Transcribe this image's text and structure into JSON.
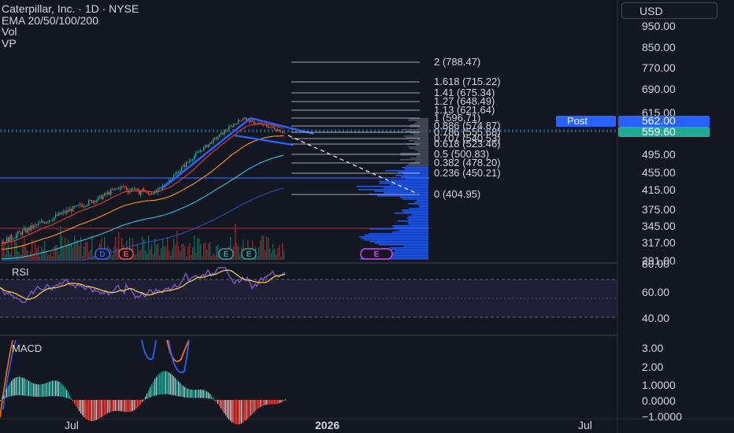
{
  "legend": {
    "symbol": "Caterpillar, Inc. · 1D · NYSE",
    "ema": "EMA 20/50/100/200",
    "vol": "Vol",
    "vp": "VP"
  },
  "currency": "USD",
  "price_axis": {
    "labels": [
      {
        "text": "950.00",
        "value": 950
      },
      {
        "text": "850.00",
        "value": 850
      },
      {
        "text": "770.00",
        "value": 770
      },
      {
        "text": "690.00",
        "value": 690
      },
      {
        "text": "615.00",
        "value": 615
      },
      {
        "text": "495.00",
        "value": 495
      },
      {
        "text": "455.00",
        "value": 455
      },
      {
        "text": "415.00",
        "value": 415
      },
      {
        "text": "375.00",
        "value": 375
      },
      {
        "text": "345.00",
        "value": 345
      },
      {
        "text": "317.00",
        "value": 317
      },
      {
        "text": "291.00",
        "value": 291
      }
    ],
    "post_label": "Post",
    "post_price": "562.00",
    "last_price": "559.60"
  },
  "fib_levels": [
    {
      "ratio": "2",
      "price": "788.47"
    },
    {
      "ratio": "1.618",
      "price": "715.22"
    },
    {
      "ratio": "1.41",
      "price": "675.34"
    },
    {
      "ratio": "1.27",
      "price": "648.49"
    },
    {
      "ratio": "1.13",
      "price": "621.64"
    },
    {
      "ratio": "1",
      "price": "596.71"
    },
    {
      "ratio": "0.886",
      "price": "574.87"
    },
    {
      "ratio": "0.786",
      "price": "555.68"
    },
    {
      "ratio": "0.707",
      "price": "540.53"
    },
    {
      "ratio": "0.618",
      "price": "523.46"
    },
    {
      "ratio": "0.5",
      "price": "500.83"
    },
    {
      "ratio": "0.382",
      "price": "478.20"
    },
    {
      "ratio": "0.236",
      "price": "450.21"
    },
    {
      "ratio": "0",
      "price": "404.95"
    }
  ],
  "event_badges": [
    "D",
    "E",
    "E",
    "E"
  ],
  "rsi": {
    "label": "RSI",
    "axis": [
      "80.00",
      "60.00",
      "40.00"
    ]
  },
  "macd": {
    "label": "MACD",
    "axis": [
      "3.00",
      "2.00",
      "1.0000",
      "0.0000",
      "−1.0000"
    ]
  },
  "time_axis": [
    "Jul",
    "2026",
    "Jul"
  ],
  "colors": {
    "background": "#131722",
    "up": "#26a69a",
    "down": "#ef5350",
    "trendline": "#2962ff",
    "rsi_line": "#7e57c2",
    "rsi_ma": "#fdd835",
    "macd_line": "#2962ff",
    "signal_line": "#ff6d00",
    "volume_profile": "#2962ff",
    "last_price_bg": "#22ab94",
    "post_bg": "#2962ff"
  }
}
